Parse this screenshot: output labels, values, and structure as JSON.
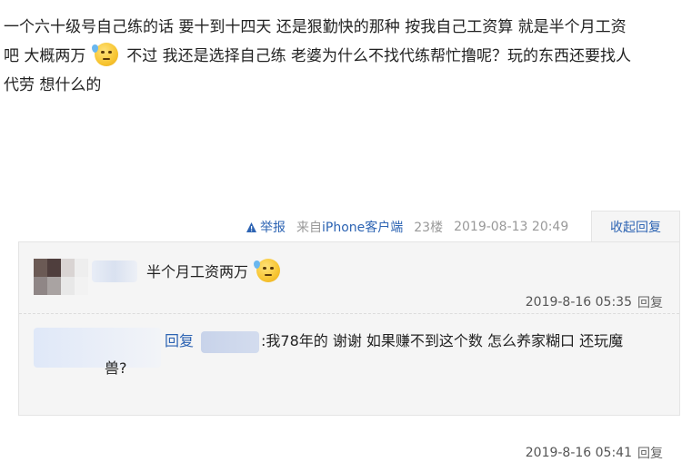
{
  "post": {
    "line1": "一个六十级号自己练的话 要十到十四天 还是狠勤快的那种 按我自己工资算 就是半个月工资",
    "line2a": "吧 大概两万",
    "line2b": "不过 我还是选择自己练 老婆为什么不找代练帮忙撸呢？玩的东西还要找人",
    "line3": "代劳 想什么的",
    "emoji_name": "sweat-smile-emoji"
  },
  "meta": {
    "report_label": "举报",
    "source_prefix": "来自",
    "source_link": "iPhone客户端",
    "floor": "23楼",
    "time": "2019-08-13 20:49",
    "collapse_label": "收起回复"
  },
  "replies": [
    {
      "text": "半个月工资两万",
      "emoji_name": "sweat-smile-emoji",
      "time": "2019-8-16 05:35",
      "reply_label": "回复",
      "avatar_colors": [
        "#6b5a55",
        "#4f3e3d",
        "#d9d4d3",
        "#eeeeee",
        "#8f8686",
        "#a9a3a2",
        "#e8e8e8",
        "#f2f2f2"
      ]
    },
    {
      "prefix": "回复",
      "text": ":我78年的 谢谢 如果赚不到这个数 怎么养家糊口 还玩魔",
      "text_cont": "兽?",
      "time": "2019-8-16 05:41",
      "reply_label": "回复"
    }
  ]
}
